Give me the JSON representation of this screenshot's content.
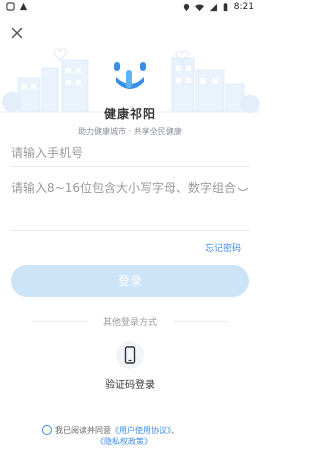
{
  "status_bar": {
    "time": "8:21",
    "icons": [
      "notification-icon",
      "app-icon",
      "location-icon",
      "wifi-icon",
      "signal-icon",
      "battery-icon"
    ]
  },
  "app": {
    "name": "健康祁阳",
    "slogan": "助力健康城市 · 共享全民健康"
  },
  "form": {
    "phone_placeholder": "请输入手机号",
    "password_placeholder": "请输入8~16位包含大小写字母、数字组合",
    "forgot_password": "忘记密码",
    "login_button": "登录"
  },
  "other_login": {
    "title": "其他登录方式",
    "sms_login": "验证码登录"
  },
  "agreement": {
    "prefix": "我已阅读并同意",
    "user_agreement": "《用户使用协议》",
    "separator": "、",
    "privacy_policy": "《隐私权政策》"
  },
  "colors": {
    "accent": "#3d8ce8",
    "login_button_bg": "#cbe4f8",
    "logo_primary": "#3a8ee6"
  }
}
